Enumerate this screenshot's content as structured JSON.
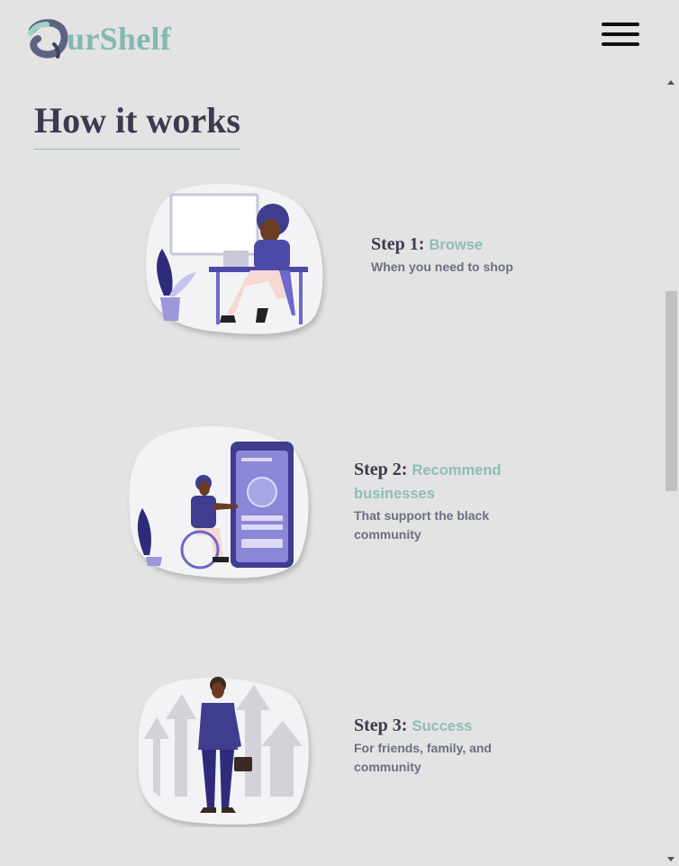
{
  "header": {
    "logo_text": "urShelf",
    "logo_icon": "brush-o-icon",
    "menu_icon": "hamburger-icon"
  },
  "main": {
    "title": "How it works",
    "steps": [
      {
        "number_label": "Step 1:",
        "name": "Browse",
        "description": "When you need to shop",
        "illustration": "woman-at-laptop-desk"
      },
      {
        "number_label": "Step 2:",
        "name": "Recommend businesses",
        "description": "That support the black community",
        "illustration": "man-in-wheelchair-phone"
      },
      {
        "number_label": "Step 3:",
        "name": "Success",
        "description": "For friends, family, and community",
        "illustration": "businessman-rising-arrows"
      }
    ]
  },
  "colors": {
    "background": "#e3e3e3",
    "accent": "#8fbdb8",
    "heading": "#3b3a4e",
    "text_muted": "#6c6f82",
    "illustration_primary": "#3f3d8e",
    "illustration_light": "#a9a6e6"
  }
}
